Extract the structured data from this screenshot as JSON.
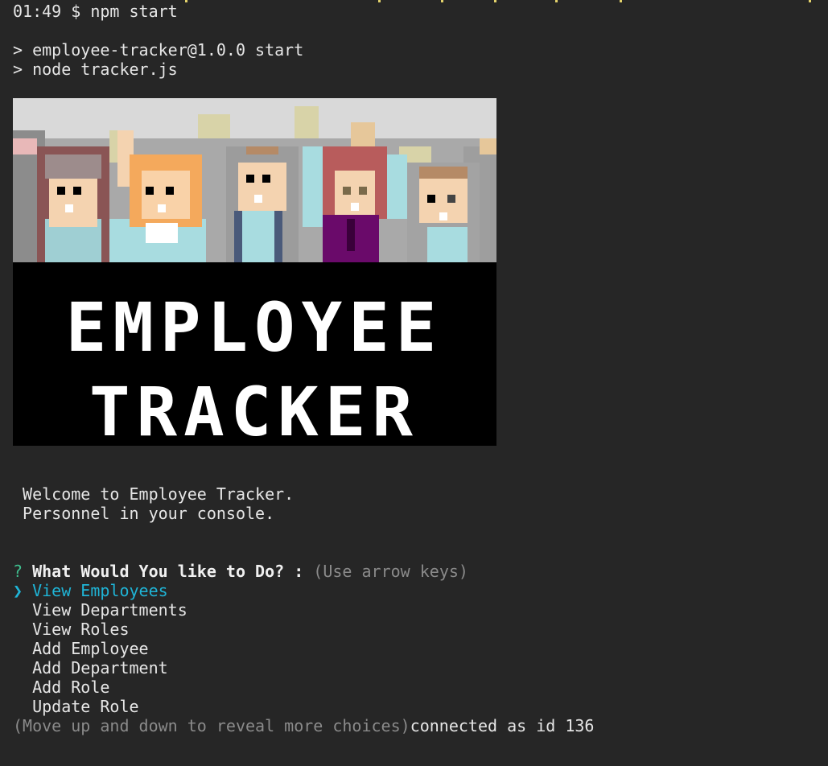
{
  "terminal": {
    "prompt_line": "01:49 $ npm start",
    "npm_line1": "> employee-tracker@1.0.0 start",
    "npm_line2": "> node tracker.js"
  },
  "banner": {
    "title_line1": "EMPLOYEE",
    "title_line2": "TRACKER"
  },
  "welcome": {
    "line1": " Welcome to Employee Tracker.",
    "line2": " Personnel in your console."
  },
  "question": {
    "marker": "?",
    "text": "What Would You like to Do? :",
    "hint": "(Use arrow keys)"
  },
  "menu": {
    "pointer": "❯",
    "selected": "View Employees",
    "items": [
      "View Departments",
      "View Roles",
      "Add Employee",
      "Add Department",
      "Add Role",
      "Update Role"
    ]
  },
  "footer": {
    "hint": "(Move up and down to reveal more choices)",
    "status": "connected as id 136"
  },
  "colors": {
    "background": "#262626",
    "question_marker": "#3fbf8f",
    "selected_item": "#1fb4d6",
    "dim_text": "#8a8a8a"
  }
}
